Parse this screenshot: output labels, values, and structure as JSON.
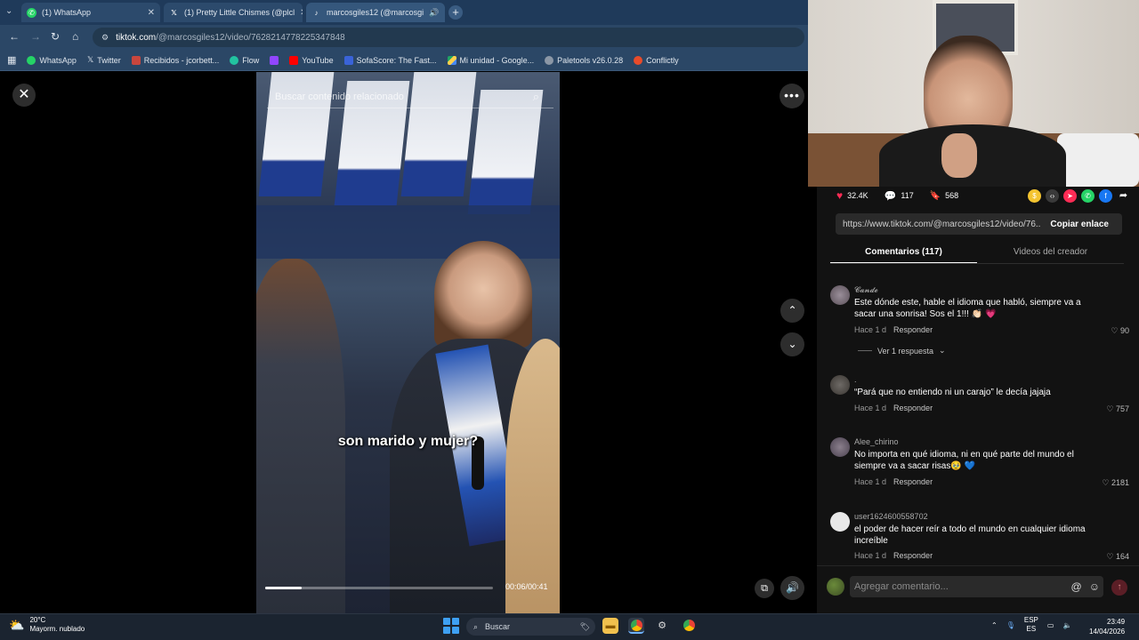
{
  "browser": {
    "tabs": [
      {
        "title": "(1) WhatsApp",
        "icon": "whatsapp-icon"
      },
      {
        "title": "(1) Pretty Little Chismes (@plcl",
        "icon": "x-icon"
      },
      {
        "title": "marcosgiles12 (@marcosgi",
        "icon": "tiktok-icon"
      }
    ],
    "url_host": "tiktok.com",
    "url_path": "/@marcosgiles12/video/7628214778225347848",
    "bookmarks": [
      "WhatsApp",
      "Twitter",
      "Recibidos - jcorbett...",
      "Flow",
      "",
      "YouTube",
      "SofaScore: The Fast...",
      "Mi unidad - Google...",
      "Paletools v26.0.28",
      "Conflictly"
    ]
  },
  "video": {
    "search_placeholder": "Buscar contenido relacionado",
    "subtitle": "son marido y mujer?",
    "timecode": "00:06/00:41",
    "progress_fraction": 0.16
  },
  "stats": {
    "likes": "32.4K",
    "comments": "117",
    "saves": "568"
  },
  "link": {
    "url": "https://www.tiktok.com/@marcosgiles12/video/76...",
    "copy_label": "Copiar enlace"
  },
  "panel_tabs": {
    "comments": "Comentarios (117)",
    "creator_videos": "Videos del creador"
  },
  "comments": [
    {
      "user": "𝓒𝓪𝓷𝓭𝓮",
      "text": "Este dónde este, hable el idioma que habló, siempre va a sacar una sonrisa! Sos el 1!!! 👏🏻 💗",
      "time": "Hace 1 d",
      "reply": "Responder",
      "likes": "90"
    },
    {
      "user": ".",
      "text": "“Pará que no entiendo ni un carajo” le decía jajaja",
      "time": "Hace 1 d",
      "reply": "Responder",
      "likes": "757"
    },
    {
      "user": "Alee_chirino",
      "text": "No importa en qué idioma, ni en qué parte del mundo el siempre va a sacar risas🥹 💙",
      "time": "Hace 1 d",
      "reply": "Responder",
      "likes": "2181"
    },
    {
      "user": "user1624600558702",
      "text": "el poder de hacer reír a todo el mundo en cualquier idioma increíble",
      "time": "Hace 1 d",
      "reply": "Responder",
      "likes": "164"
    }
  ],
  "view_replies": "Ver 1 respuesta",
  "composer": {
    "placeholder": "Agregar comentario..."
  },
  "taskbar": {
    "temp": "20°C",
    "weather": "Mayorm. nublado",
    "search": "Buscar",
    "lang": "ESP",
    "lang2": "ES",
    "time": "23:49",
    "date": "14/04/2026"
  },
  "colors": {
    "like": "#fe2c55",
    "accent_tab": "#1f3a5a",
    "panel_bg": "#121212"
  }
}
